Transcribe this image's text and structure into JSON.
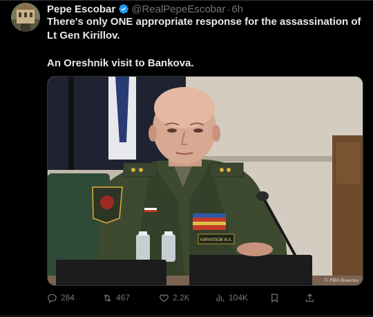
{
  "tweet": {
    "author": {
      "display_name": "Pepe Escobar",
      "handle": "@RealPepeEscobar",
      "verified": true
    },
    "separator": "·",
    "time": "6h",
    "text_line1": "There's only ONE appropriate response for the assassination of Lt Gen Kirillov.",
    "text_line2": "An Oreshnik visit to Bankova.",
    "media": {
      "name_tag": "КИРИЛЛОВ И.А.",
      "watermark": "© РИА Новости"
    },
    "actions": {
      "replies": "284",
      "reposts": "467",
      "likes": "2.2K",
      "views": "104K"
    }
  },
  "colors": {
    "background": "#000000",
    "text": "#e7e9ea",
    "muted": "#71767b",
    "verified": "#1d9bf0",
    "border": "#2f3336"
  },
  "icons": [
    "verified-badge-icon",
    "reply-icon",
    "repost-icon",
    "like-icon",
    "views-icon",
    "bookmark-icon",
    "share-icon"
  ]
}
